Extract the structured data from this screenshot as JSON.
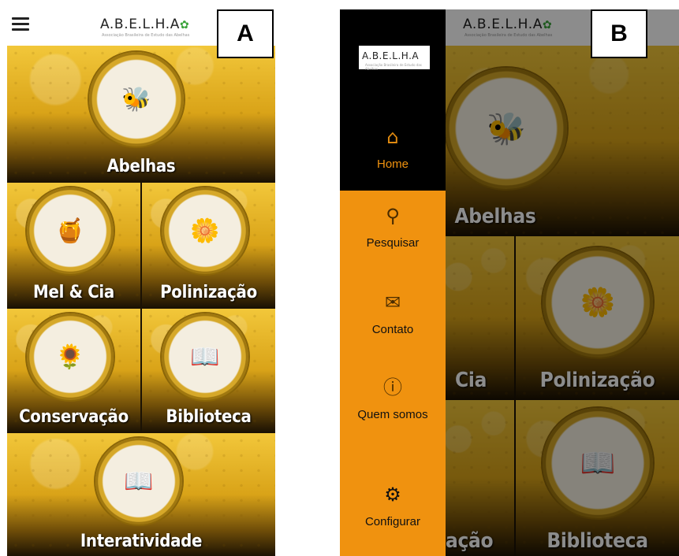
{
  "panel_a": {
    "label": "A",
    "logo_text": "A.B.E.L.H.A",
    "logo_subtitle": "Associação Brasileira de Estudo das Abelhas",
    "tiles": [
      {
        "title": "Abelhas",
        "icon": "bees-icon"
      },
      {
        "title": "Mel & Cia",
        "icon": "honey-jar-icon"
      },
      {
        "title": "Polinização",
        "icon": "flower-bee-icon"
      },
      {
        "title": "Conservação",
        "icon": "hand-flower-icon"
      },
      {
        "title": "Biblioteca",
        "icon": "book-bee-icon"
      },
      {
        "title": "Interatividade",
        "icon": "book-bee-icon"
      }
    ]
  },
  "panel_b": {
    "label": "B",
    "logo_text": "A.B.E.L.H.A",
    "logo_subtitle": "Associação Brasileira de Estudo das Abelhas",
    "drawer": {
      "logo_text": "A.B.E.L.H.A",
      "logo_subtitle": "Associação Brasileira de Estudo das Abelhas",
      "items": [
        {
          "label": "Home",
          "icon": "home-icon",
          "active": true
        },
        {
          "label": "Pesquisar",
          "icon": "search-icon"
        },
        {
          "label": "Contato",
          "icon": "mail-icon"
        },
        {
          "label": "Quem somos",
          "icon": "info-icon"
        },
        {
          "label": "Configurar",
          "icon": "gear-icon"
        }
      ]
    },
    "background_tiles": [
      {
        "title": "Abelhas"
      },
      {
        "title": "Cia"
      },
      {
        "title": "Polinização"
      },
      {
        "title": "ação"
      },
      {
        "title": "Biblioteca"
      }
    ]
  },
  "colors": {
    "drawer_bg": "#f0920f",
    "drawer_header_bg": "#000000",
    "honeycomb_gold": "#d9a318",
    "title_text": "#ffffff"
  }
}
